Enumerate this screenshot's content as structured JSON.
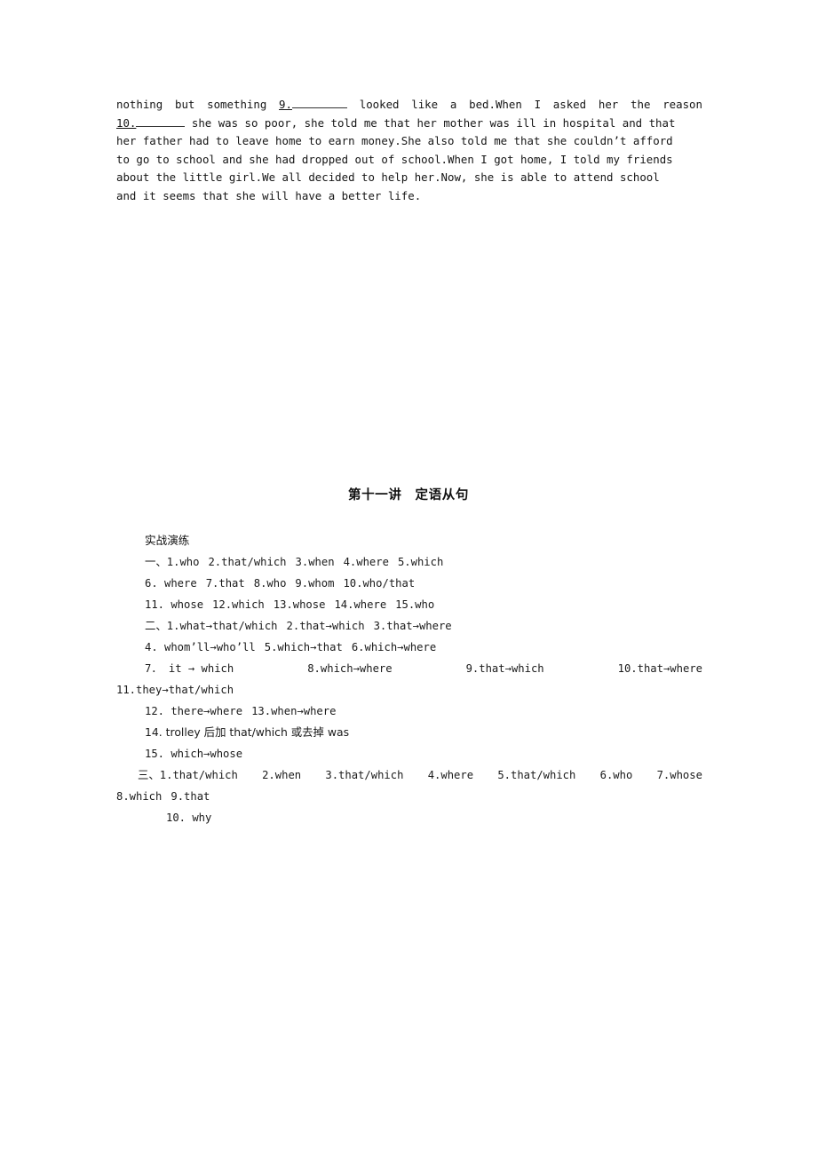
{
  "document": {
    "page_background": "#ffffff",
    "text_color": "#151515"
  },
  "passage": {
    "name": "continued-cloze-passage",
    "lines": [
      {
        "parts": [
          "nothing",
          "but",
          "something",
          {
            "type": "blank",
            "number": "9.",
            "width": 62
          },
          "looked",
          "like",
          "a",
          "bed.When",
          "I",
          "asked",
          "her",
          "the",
          "reason"
        ]
      },
      {
        "parts": [
          {
            "type": "blank",
            "number": "10.",
            "width": 55
          },
          "she was so poor, she told me that her mother was ill in hospital and that"
        ]
      },
      {
        "text": "her father had to leave home to earn money.She also told me that she couldn’t afford"
      },
      {
        "text": "to go to school and she had dropped out of school.When I got home, I told my friends"
      },
      {
        "text": "about the little girl.We all decided to help her.Now, she is able to attend school"
      },
      {
        "text": "and it seems that she will have a better life."
      }
    ],
    "full_text": "nothing but something 9.______ looked like a bed.When I asked her the reason 10.______ she was so poor, she told me that her mother was ill in hospital and that her father had to leave home to earn money.She also told me that she couldn’t afford to go to school and she had dropped out of school.When I got home, I told my friends about the little girl.We all decided to help her.Now, she is able to attend school and it seems that she will have a better life."
  },
  "chapter": {
    "heading": "第十一讲　定语从句"
  },
  "answer_key": {
    "section_title": "实战演练",
    "part_one": {
      "marker": "一、",
      "rows": [
        [
          "1.who",
          "2.that/which",
          "3.when",
          "4.where",
          "5.which"
        ],
        [
          "6. where",
          "7.that",
          "8.who",
          "9.whom",
          "10.who/that"
        ],
        [
          "11. whose",
          "12.which",
          "13.whose",
          "14.where",
          "15.who"
        ]
      ]
    },
    "part_two": {
      "marker": "二、",
      "rows": [
        [
          "1.what→that/which",
          "2.that→which",
          "3.that→where"
        ],
        [
          "4. whom’ll→who’ll",
          "5.which→that",
          "6.which→where"
        ],
        [
          "7．  it → which",
          "8.which→where",
          "9.that→which",
          "10.that→where"
        ],
        [
          "11.they→that/which"
        ],
        [
          "12. there→where",
          "13.when→where"
        ],
        [
          "14. trolley 后加 that/which 或去掉 was"
        ],
        [
          "15. which→whose"
        ]
      ]
    },
    "part_three": {
      "marker": "三、",
      "rows": [
        [
          "1.that/which",
          "2.when",
          "3.that/which",
          "4.where",
          "5.that/which",
          "6.who",
          "7.whose"
        ],
        [
          "8.which",
          "9.that"
        ],
        [
          "10. why"
        ]
      ]
    }
  }
}
